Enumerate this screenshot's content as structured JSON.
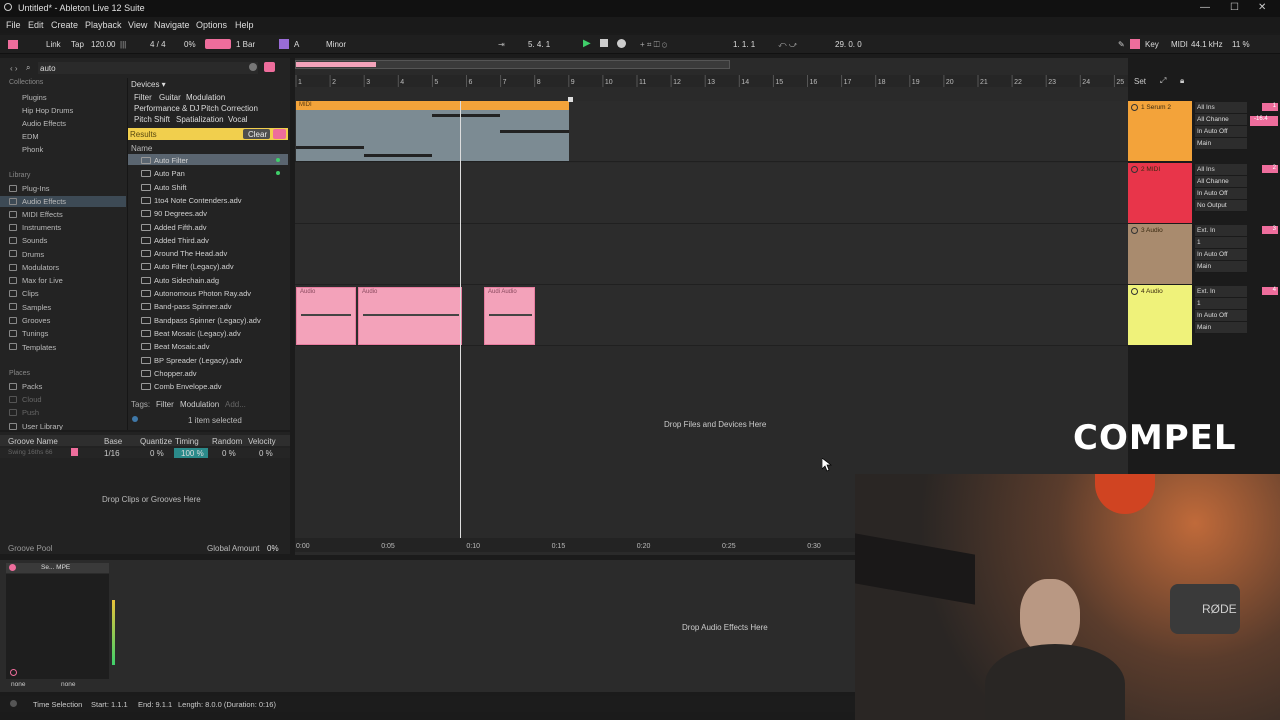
{
  "titlebar": {
    "title": "Untitled* - Ableton Live 12 Suite",
    "min": "—",
    "max": "☐",
    "close": "✕"
  },
  "menu": [
    "File",
    "Edit",
    "Create",
    "Playback",
    "View",
    "Navigate",
    "Options",
    "Help"
  ],
  "control": {
    "link": "Link",
    "tap": "Tap",
    "tempo": "120.00",
    "time_sig": "4 / 4",
    "cpu_percent": "0%",
    "quantize": "1 Bar",
    "scale_root": "A",
    "scale_mode": "Minor",
    "position": "5.  4.  1",
    "loop_start": "1.  1.  1",
    "loop_length": "29.  0.  0",
    "key": "Key",
    "midi": "MIDI",
    "sample_rate": "44.1 kHz",
    "cpu_load": "11 %"
  },
  "browser": {
    "search_value": "auto",
    "collections_header": "Collections",
    "collections": [
      {
        "label": "Plugins",
        "color": "#e5533d"
      },
      {
        "label": "Hip Hop Drums",
        "color": "#e89b2d"
      },
      {
        "label": "Audio Effects",
        "color": "#3ab09e"
      },
      {
        "label": "EDM",
        "color": "#2d7fd8"
      },
      {
        "label": "Phonk",
        "color": "#6c6cd8"
      }
    ],
    "library_header": "Library",
    "library": [
      "Plug-Ins",
      "Audio Effects",
      "MIDI Effects",
      "Instruments",
      "Sounds",
      "Drums",
      "Modulators",
      "Max for Live",
      "Clips",
      "Samples",
      "Grooves",
      "Tunings",
      "Templates"
    ],
    "places_header": "Places",
    "places": [
      "Packs",
      "Cloud",
      "Push",
      "User Library"
    ],
    "devices_label": "Devices ▾",
    "filters": [
      "Filter",
      "Guitar",
      "Modulation",
      "Performance & DJ",
      "Pitch Correction",
      "Pitch Shift",
      "Spatialization",
      "Vocal"
    ],
    "results_label": "Results",
    "clear_label": "Clear",
    "name_header": "Name",
    "results": [
      "Auto Filter",
      "Auto Pan",
      "Auto Shift",
      "1to4 Note Contenders.adv",
      "90 Degrees.adv",
      "Added Fifth.adv",
      "Added Third.adv",
      "Around The Head.adv",
      "Auto Filter (Legacy).adv",
      "Auto Sidechain.adg",
      "Autonomous Photon Ray.adv",
      "Band-pass Spinner.adv",
      "Bandpass Spinner (Legacy).adv",
      "Beat Mosaic (Legacy).adv",
      "Beat Mosaic.adv",
      "BP Spreader (Legacy).adv",
      "Chopper.adv",
      "Comb Envelope.adv"
    ],
    "tags_label": "Tags:",
    "tag_filter": "Filter",
    "tag_modulation": "Modulation",
    "tag_add": "Add...",
    "selection_info": "1 item selected"
  },
  "groove": {
    "headers": [
      "Groove Name",
      "Base",
      "Quantize",
      "Timing",
      "Random",
      "Velocity"
    ],
    "row": {
      "name": "Swing 16ths 66",
      "base": "1/16",
      "quantize": "0 %",
      "timing": "100 %",
      "random": "0 %",
      "velocity": "0 %"
    },
    "drop_text": "Drop Clips or Grooves Here",
    "pool_label": "Groove Pool",
    "global_amount_label": "Global Amount",
    "global_amount": "0%"
  },
  "arrangement": {
    "bar_numbers": [
      "1",
      "2",
      "3",
      "4",
      "5",
      "6",
      "7",
      "8",
      "9",
      "10",
      "11",
      "12",
      "13",
      "14",
      "15",
      "16",
      "17",
      "18",
      "19",
      "20",
      "21",
      "22",
      "23",
      "24",
      "25"
    ],
    "time_labels": [
      "0:00",
      "0:05",
      "0:10",
      "0:15",
      "0:20",
      "0:25",
      "0:30"
    ],
    "midi_clip_label": "MIDI",
    "audio_clips": [
      "Audio",
      "Audio",
      "Audi Audio"
    ],
    "drop_text": "Drop Files and Devices Here",
    "set_label": "Set"
  },
  "tracks": [
    {
      "name": "1 Serum 2",
      "color": "#f3a33a",
      "num": "1",
      "io": [
        "All Ins",
        "All Channe",
        "In  Auto  Off",
        "Main"
      ],
      "meter": "-16.4"
    },
    {
      "name": "2 MIDI",
      "color": "#e8354a",
      "num": "2",
      "io": [
        "All Ins",
        "All Channe",
        "In  Auto  Off",
        "No Output"
      ]
    },
    {
      "name": "3 Audio",
      "color": "#a98b6e",
      "num": "3",
      "io": [
        "Ext. In",
        "1",
        "In  Auto  Off",
        "Main"
      ]
    },
    {
      "name": "4 Audio",
      "color": "#eff27a",
      "num": "4",
      "io": [
        "Ext. In",
        "1",
        "In  Auto  Off",
        "Main"
      ]
    }
  ],
  "device_view": {
    "device_title": "Se... MPE",
    "drop_text": "Drop Audio Effects Here",
    "chain_left": "none",
    "chain_right": "none"
  },
  "status": {
    "label": "Time Selection",
    "start": "Start: 1.1.1",
    "end": "End: 9.1.1",
    "length": "Length: 8.0.0  (Duration: 0:16)"
  },
  "overlay": {
    "watermark": "COMPEL",
    "mic_brand": "RØDE"
  }
}
